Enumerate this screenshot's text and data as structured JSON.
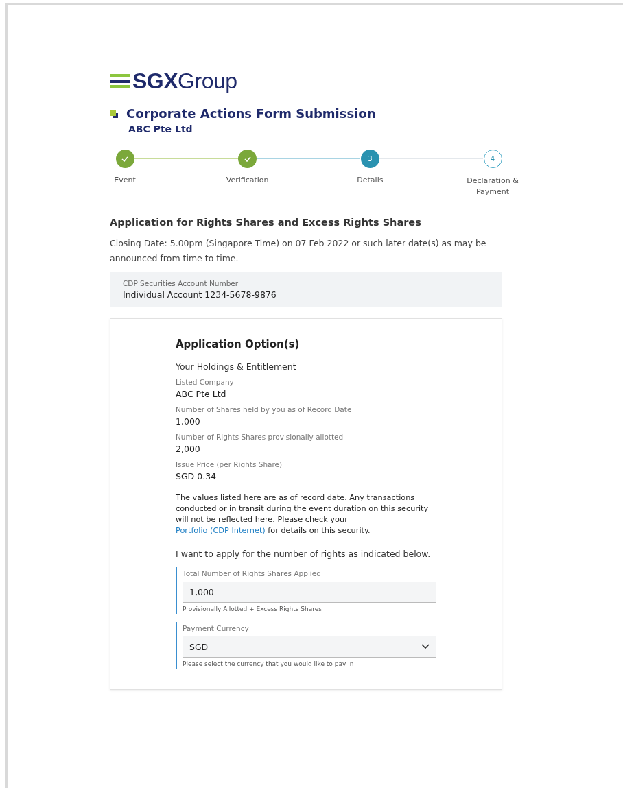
{
  "logo": {
    "bold": "SGX",
    "rest": "Group"
  },
  "header": {
    "title": "Corporate Actions Form Submission",
    "company": "ABC Pte Ltd"
  },
  "steps": [
    {
      "label": "Event",
      "completed": true,
      "selected": false
    },
    {
      "label": "Verification",
      "completed": true,
      "selected": false
    },
    {
      "label": "Details",
      "number": "3",
      "completed": false,
      "selected": true
    },
    {
      "label": "Declaration & Payment",
      "number": "4",
      "completed": false,
      "selected": false
    }
  ],
  "heading": "Application for Rights Shares and Excess Rights Shares",
  "closing_note": "Closing Date: 5.00pm (Singapore Time) on 07 Feb 2022 or such later date(s) as may be announced from time to time.",
  "account": {
    "label": "CDP Securities Account Number",
    "value": "Individual Account 1234-5678-9876"
  },
  "card": {
    "title": "Application Option(s)",
    "subtitle": "Your Holdings & Entitlement",
    "fields": [
      {
        "label": "Listed Company",
        "value": "ABC Pte Ltd"
      },
      {
        "label": "Number of Shares held by you as of Record Date",
        "value": "1,000"
      },
      {
        "label": "Number of Rights Shares provisionally allotted",
        "value": "2,000"
      },
      {
        "label": "Issue Price (per Rights Share)",
        "value": "SGD 0.34"
      }
    ],
    "note": {
      "before": "The values listed here are as of record date. Any transactions conducted or in transit during the event duration on this security will not be reflected here. Please check your ",
      "link": "Portfolio (CDP Internet)",
      "after": " for details on this security."
    },
    "apply_text": "I want to apply for the number of rights as indicated below.",
    "inputs": [
      {
        "kind": "text",
        "label": "Total Number of Rights Shares Applied",
        "value": "1,000",
        "hint": "Provisionally Allotted + Excess Rights Shares"
      },
      {
        "kind": "select",
        "label": "Payment Currency",
        "value": "SGD",
        "hint": "Please select the currency that you would like to pay in"
      }
    ]
  }
}
